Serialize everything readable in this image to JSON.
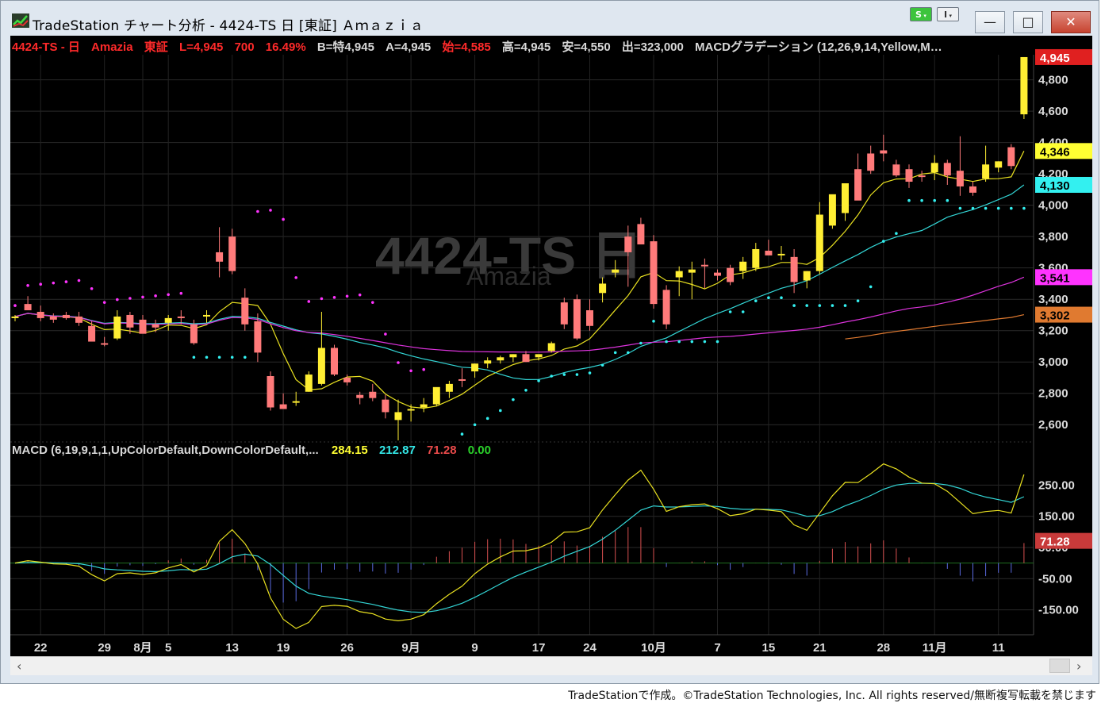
{
  "window": {
    "title": "TradeStation チャート分析 - 4424-TS 日 [東証] Ａｍａｚｉａ",
    "btn_s": "S",
    "btn_i": "I",
    "minimize": "—",
    "maximize": "□",
    "close": "✕"
  },
  "header": {
    "symbol": "4424-TS - 日",
    "name": "Amazia",
    "exchange": "東証",
    "last": "L=4,945",
    "change": "700",
    "pct": "16.49%",
    "bid": "B=特4,945",
    "ask": "A=4,945",
    "open": "始=4,585",
    "high": "高=4,945",
    "low": "安=4,550",
    "volume": "出=323,000",
    "indicator": "MACDグラデーション (12,26,9,14,Yellow,M…"
  },
  "watermark": {
    "symbol": "4424-TS 日",
    "name": "Amazia"
  },
  "price_axis": {
    "ticks": [
      "4,800",
      "4,600",
      "4,400",
      "4,200",
      "4,000",
      "3,800",
      "3,600",
      "3,400",
      "3,200",
      "3,000",
      "2,800",
      "2,600"
    ],
    "markers": [
      {
        "label": "4,945",
        "bg": "#e02020",
        "fg": "#ffffff"
      },
      {
        "label": "4,346",
        "bg": "#ffff33",
        "fg": "#000000"
      },
      {
        "label": "4,130",
        "bg": "#33f0f0",
        "fg": "#000000"
      },
      {
        "label": "3,541",
        "bg": "#ff33ff",
        "fg": "#000000"
      },
      {
        "label": "3,302",
        "bg": "#e07a30",
        "fg": "#000000"
      }
    ]
  },
  "macd": {
    "label": "MACD (6,19,9,1,1,UpColorDefault,DownColorDefault,...",
    "macd_value": "284.15",
    "signal_value": "212.87",
    "hist_value": "71.28",
    "zero_value": "0.00",
    "ticks": [
      "250.00",
      "150.00",
      "50.00",
      "-50.00",
      "-150.00"
    ],
    "marker": {
      "label": "71.28",
      "bg": "#c83a3a",
      "fg": "#ffffff"
    }
  },
  "x_axis": [
    "22",
    "29",
    "8月",
    "5",
    "13",
    "19",
    "26",
    "9月",
    "9",
    "17",
    "24",
    "10月",
    "7",
    "15",
    "21",
    "28",
    "11月",
    "11"
  ],
  "colors": {
    "up": "#ffee33",
    "down": "#ff7a7a",
    "ma_fast": "#e8e020",
    "ma_mid": "#33d6d6",
    "ma_slow": "#dd33dd",
    "ma_long": "#e07a30",
    "sar_hi": "#ff33ff",
    "sar_lo": "#33f0f0"
  },
  "chart_data": {
    "type": "candlestick",
    "candles": [
      [
        3280,
        3300,
        3260,
        3290
      ],
      [
        3370,
        3420,
        3340,
        3330
      ],
      [
        3320,
        3360,
        3260,
        3280
      ],
      [
        3290,
        3310,
        3250,
        3270
      ],
      [
        3300,
        3320,
        3270,
        3280
      ],
      [
        3290,
        3320,
        3230,
        3250
      ],
      [
        3230,
        3260,
        3150,
        3130
      ],
      [
        3120,
        3160,
        3100,
        3110
      ],
      [
        3150,
        3330,
        3140,
        3290
      ],
      [
        3300,
        3320,
        3180,
        3220
      ],
      [
        3270,
        3300,
        3200,
        3180
      ],
      [
        3240,
        3270,
        3190,
        3220
      ],
      [
        3250,
        3300,
        3200,
        3280
      ],
      [
        3290,
        3330,
        3240,
        3280
      ],
      [
        3240,
        3270,
        3110,
        3120
      ],
      [
        3290,
        3330,
        3250,
        3300
      ],
      [
        3700,
        3860,
        3540,
        3640
      ],
      [
        3800,
        3850,
        3560,
        3580
      ],
      [
        3410,
        3470,
        3200,
        3240
      ],
      [
        3260,
        3310,
        3000,
        3060
      ],
      [
        2910,
        2940,
        2690,
        2710
      ],
      [
        2730,
        2800,
        2710,
        2700
      ],
      [
        2750,
        2810,
        2720,
        2750
      ],
      [
        2810,
        2940,
        2810,
        2920
      ],
      [
        2860,
        3320,
        2850,
        3090
      ],
      [
        3090,
        3110,
        2910,
        2920
      ],
      [
        2900,
        2920,
        2850,
        2870
      ],
      [
        2790,
        2810,
        2730,
        2770
      ],
      [
        2810,
        2860,
        2750,
        2770
      ],
      [
        2760,
        2790,
        2640,
        2680
      ],
      [
        2630,
        2760,
        2500,
        2680
      ],
      [
        2690,
        2730,
        2620,
        2700
      ],
      [
        2710,
        2770,
        2680,
        2730
      ],
      [
        2730,
        2760,
        2720,
        2840
      ],
      [
        2810,
        2880,
        2770,
        2860
      ],
      [
        2890,
        2960,
        2840,
        2880
      ],
      [
        2940,
        2990,
        2900,
        2990
      ],
      [
        2990,
        3030,
        2960,
        3010
      ],
      [
        3010,
        3040,
        2990,
        3030
      ],
      [
        3030,
        3050,
        3000,
        3050
      ],
      [
        3050,
        3070,
        3000,
        3000
      ],
      [
        3030,
        3040,
        3010,
        3050
      ],
      [
        3070,
        3130,
        3060,
        3120
      ],
      [
        3380,
        3410,
        3210,
        3240
      ],
      [
        3400,
        3430,
        3140,
        3150
      ],
      [
        3330,
        3400,
        3200,
        3230
      ],
      [
        3440,
        3540,
        3380,
        3500
      ],
      [
        3570,
        3650,
        3540,
        3590
      ],
      [
        3800,
        3870,
        3480,
        3700
      ],
      [
        3880,
        3920,
        3760,
        3750
      ],
      [
        3770,
        3810,
        3340,
        3370
      ],
      [
        3460,
        3490,
        3210,
        3240
      ],
      [
        3540,
        3610,
        3420,
        3580
      ],
      [
        3570,
        3640,
        3400,
        3590
      ],
      [
        3620,
        3660,
        3470,
        3610
      ],
      [
        3570,
        3590,
        3520,
        3550
      ],
      [
        3600,
        3620,
        3490,
        3510
      ],
      [
        3580,
        3670,
        3530,
        3640
      ],
      [
        3600,
        3760,
        3580,
        3720
      ],
      [
        3710,
        3780,
        3690,
        3680
      ],
      [
        3690,
        3740,
        3650,
        3690
      ],
      [
        3670,
        3720,
        3440,
        3510
      ],
      [
        3520,
        3580,
        3470,
        3580
      ],
      [
        3580,
        4020,
        3560,
        3940
      ],
      [
        3870,
        4060,
        3850,
        4070
      ],
      [
        3950,
        4130,
        3900,
        4140
      ],
      [
        4230,
        4330,
        4170,
        4030
      ],
      [
        4330,
        4380,
        4200,
        4220
      ],
      [
        4350,
        4450,
        4280,
        4330
      ],
      [
        4260,
        4290,
        4180,
        4190
      ],
      [
        4230,
        4260,
        4110,
        4150
      ],
      [
        4190,
        4220,
        4150,
        4180
      ],
      [
        4210,
        4320,
        4160,
        4270
      ],
      [
        4270,
        4290,
        4130,
        4190
      ],
      [
        4220,
        4440,
        4060,
        4120
      ],
      [
        4120,
        4150,
        4060,
        4080
      ],
      [
        4170,
        4380,
        4150,
        4260
      ],
      [
        4240,
        4280,
        4210,
        4280
      ],
      [
        4370,
        4390,
        4230,
        4250
      ],
      [
        4580,
        4945,
        4550,
        4945
      ]
    ],
    "ma_fast_last": 4346,
    "ma_mid_last": 4130,
    "ma_slow_last": 3541,
    "ma_long_last": 3302,
    "macd_last": 284.15,
    "signal_last": 212.87,
    "hist_last": 71.28,
    "ylim_price": [
      2500,
      4960
    ],
    "ylim_macd": [
      -230,
      330
    ]
  }
}
